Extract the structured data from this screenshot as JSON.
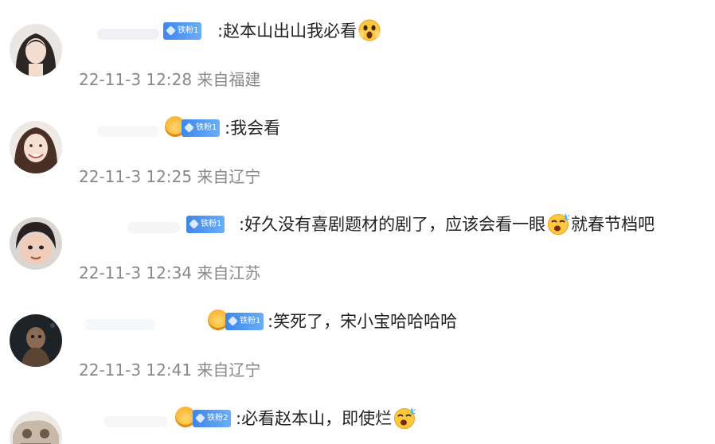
{
  "comments": [
    {
      "badge": "铁粉1",
      "text": ":赵本山出山我必看",
      "emoji": "shocked-face-emoji",
      "trailing": "",
      "time": "22-11-3 12:28",
      "location": "来自福建"
    },
    {
      "badge": "铁粉1",
      "text": ":我会看",
      "emoji": "",
      "trailing": "",
      "time": "22-11-3 12:25",
      "location": "来自辽宁"
    },
    {
      "badge": "铁粉1",
      "text": ":好久没有喜剧题材的剧了，应该会看一眼",
      "emoji": "sweat-face-emoji",
      "trailing": "就春节档吧",
      "time": "22-11-3 12:34",
      "location": "来自江苏"
    },
    {
      "badge": "铁粉1",
      "text": ":笑死了，宋小宝哈哈哈哈",
      "emoji": "",
      "trailing": "",
      "time": "22-11-3 12:41",
      "location": "来自辽宁"
    },
    {
      "badge": "铁粉2",
      "text": ":必看赵本山，即使烂",
      "emoji": "sweat-face-emoji",
      "trailing": "",
      "time": "",
      "location": ""
    }
  ]
}
